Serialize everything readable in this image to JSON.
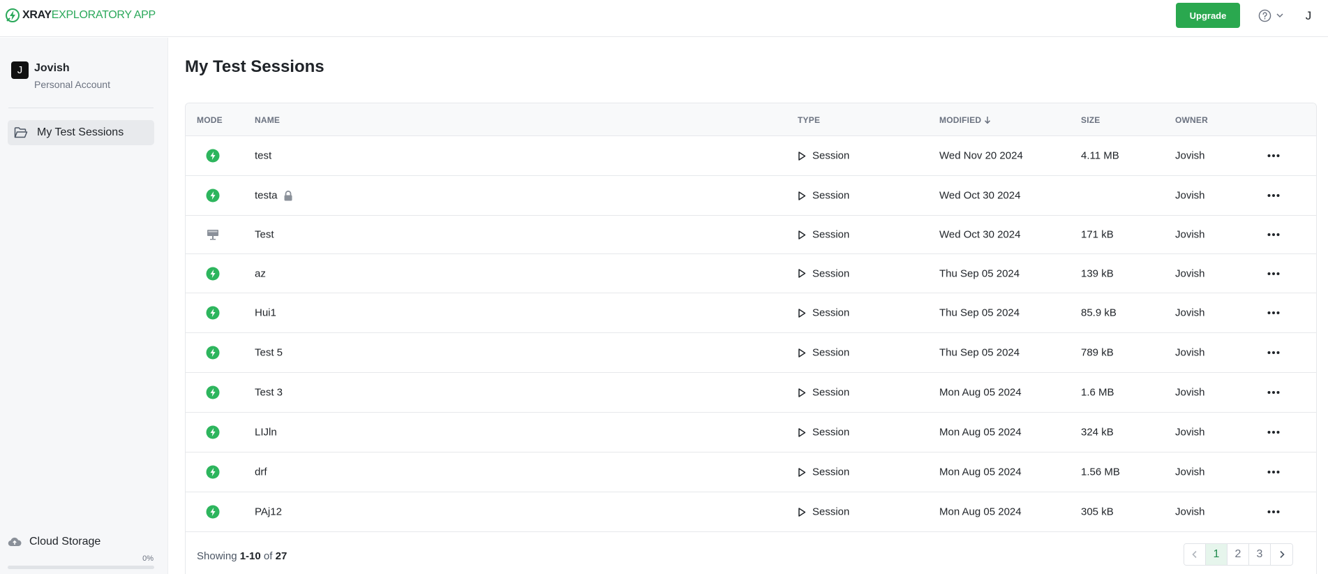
{
  "header": {
    "logo_bold": "XRAY",
    "logo_rest": "EXPLORATORY APP",
    "upgrade_label": "Upgrade",
    "avatar_initial": "J"
  },
  "sidebar": {
    "account_initial": "J",
    "account_name": "Jovish",
    "account_type": "Personal Account",
    "nav_item_label": "My Test Sessions",
    "cloud_label": "Cloud Storage",
    "cloud_usage": "0%",
    "cloud_usage_fraction": 0
  },
  "main": {
    "title": "My Test Sessions",
    "columns": {
      "mode": "MODE",
      "name": "NAME",
      "type": "TYPE",
      "modified": "MODIFIED",
      "size": "SIZE",
      "owner": "OWNER"
    },
    "rows": [
      {
        "mode": "bolt",
        "name": "test",
        "locked": false,
        "type": "Session",
        "modified": "Wed Nov 20 2024",
        "size": "4.11 MB",
        "owner": "Jovish"
      },
      {
        "mode": "bolt",
        "name": "testa",
        "locked": true,
        "type": "Session",
        "modified": "Wed Oct 30 2024",
        "size": "",
        "owner": "Jovish"
      },
      {
        "mode": "desktop",
        "name": "Test",
        "locked": false,
        "type": "Session",
        "modified": "Wed Oct 30 2024",
        "size": "171 kB",
        "owner": "Jovish"
      },
      {
        "mode": "bolt",
        "name": "az",
        "locked": false,
        "type": "Session",
        "modified": "Thu Sep 05 2024",
        "size": "139 kB",
        "owner": "Jovish"
      },
      {
        "mode": "bolt",
        "name": "Hui1",
        "locked": false,
        "type": "Session",
        "modified": "Thu Sep 05 2024",
        "size": "85.9 kB",
        "owner": "Jovish"
      },
      {
        "mode": "bolt",
        "name": "Test 5",
        "locked": false,
        "type": "Session",
        "modified": "Thu Sep 05 2024",
        "size": "789 kB",
        "owner": "Jovish"
      },
      {
        "mode": "bolt",
        "name": "Test 3",
        "locked": false,
        "type": "Session",
        "modified": "Mon Aug 05 2024",
        "size": "1.6 MB",
        "owner": "Jovish"
      },
      {
        "mode": "bolt",
        "name": "LIJln",
        "locked": false,
        "type": "Session",
        "modified": "Mon Aug 05 2024",
        "size": "324 kB",
        "owner": "Jovish"
      },
      {
        "mode": "bolt",
        "name": "drf",
        "locked": false,
        "type": "Session",
        "modified": "Mon Aug 05 2024",
        "size": "1.56 MB",
        "owner": "Jovish"
      },
      {
        "mode": "bolt",
        "name": "PAj12",
        "locked": false,
        "type": "Session",
        "modified": "Mon Aug 05 2024",
        "size": "305 kB",
        "owner": "Jovish"
      }
    ],
    "footer": {
      "showing_prefix": "Showing",
      "range": "1-10",
      "of": "of",
      "total": "27"
    },
    "pagination": {
      "pages": [
        "1",
        "2",
        "3"
      ],
      "current": "1"
    }
  },
  "colors": {
    "accent_green": "#2aa84f",
    "mode_bolt_green": "#2db55d",
    "mode_desktop_gray": "#8a9099"
  }
}
